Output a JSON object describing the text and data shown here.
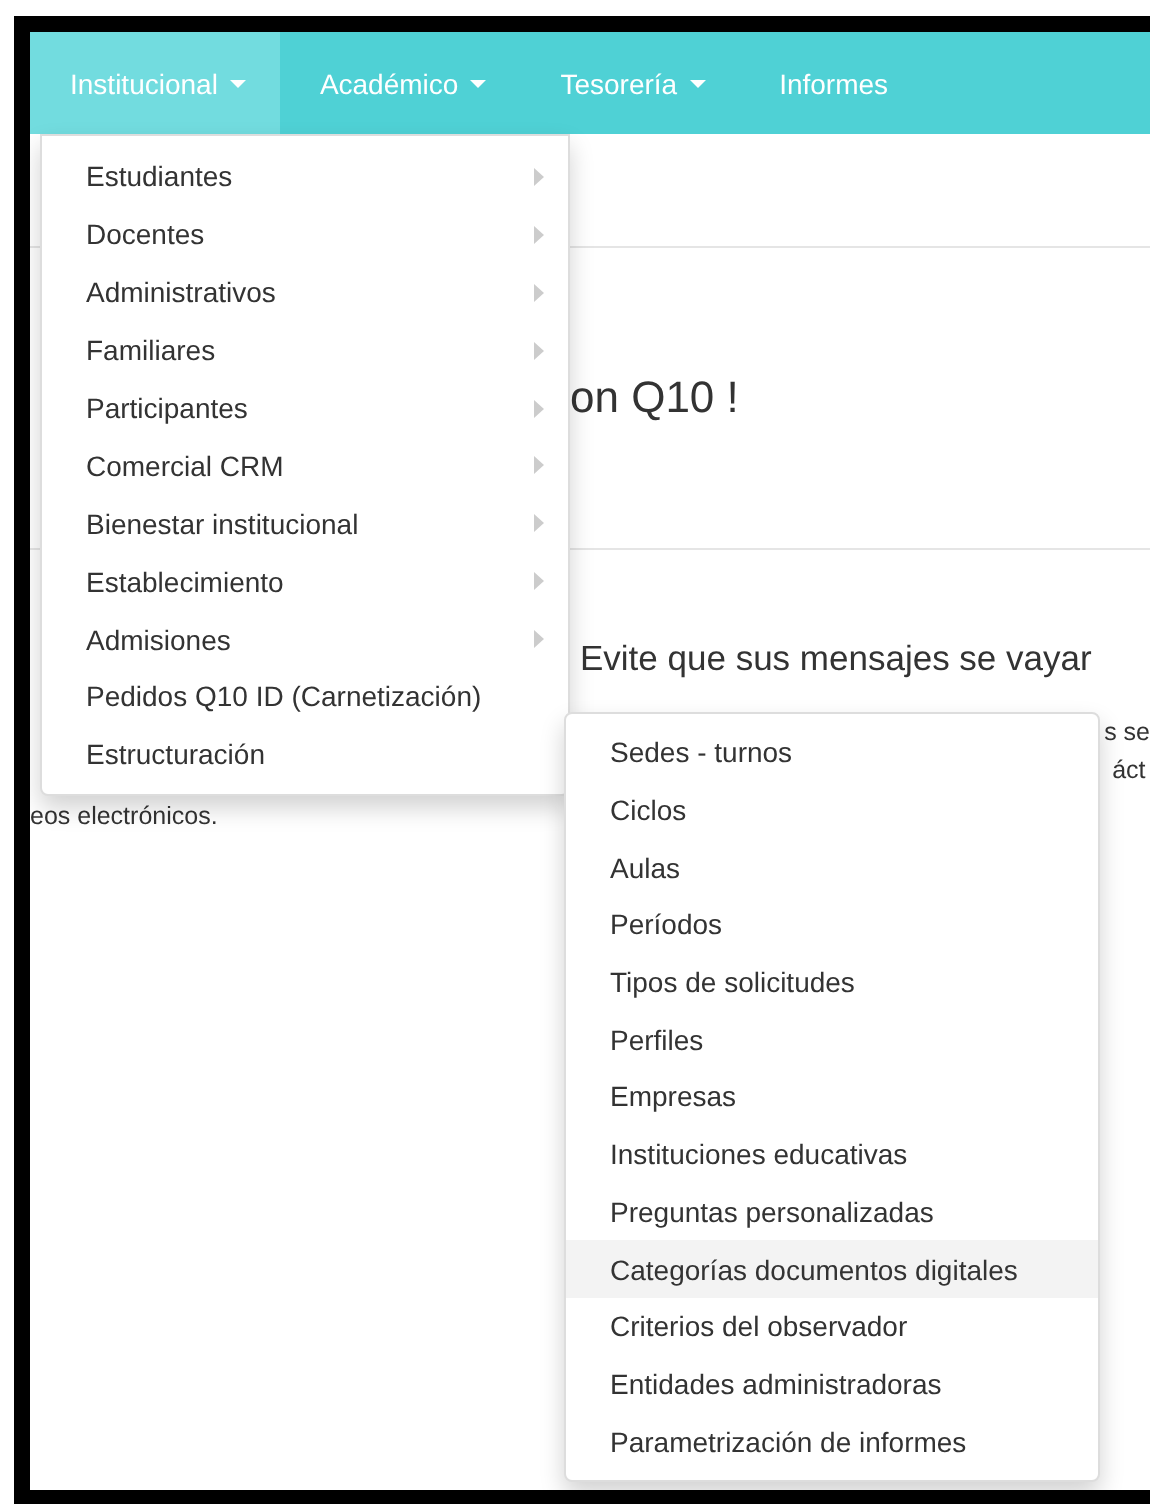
{
  "navbar": {
    "items": [
      {
        "label": "Institucional",
        "dropdown": true,
        "selected": true
      },
      {
        "label": "Académico",
        "dropdown": true,
        "selected": false
      },
      {
        "label": "Tesorería",
        "dropdown": true,
        "selected": false
      },
      {
        "label": "Informes",
        "dropdown": false,
        "selected": false
      }
    ]
  },
  "background": {
    "heading_right": "on Q10 !",
    "subheading": "Evite que sus mensajes se vayar",
    "text_left": [
      "eos electrónicos."
    ],
    "text_right": [
      "s se",
      "áct"
    ]
  },
  "menu": {
    "items": [
      {
        "label": "Estudiantes",
        "submenu": true
      },
      {
        "label": "Docentes",
        "submenu": true
      },
      {
        "label": "Administrativos",
        "submenu": true
      },
      {
        "label": "Familiares",
        "submenu": true
      },
      {
        "label": "Participantes",
        "submenu": true
      },
      {
        "label": "Comercial CRM",
        "submenu": true
      },
      {
        "label": "Bienestar institucional",
        "submenu": true
      },
      {
        "label": "Establecimiento",
        "submenu": true
      },
      {
        "label": "Admisiones",
        "submenu": true
      },
      {
        "label": "Pedidos Q10 ID (Carnetización)",
        "submenu": false
      },
      {
        "label": "Estructuración",
        "submenu": false
      }
    ]
  },
  "submenu": {
    "items": [
      {
        "label": "Sedes - turnos",
        "selected": false
      },
      {
        "label": "Ciclos",
        "selected": false
      },
      {
        "label": "Aulas",
        "selected": false
      },
      {
        "label": "Períodos",
        "selected": false
      },
      {
        "label": "Tipos de solicitudes",
        "selected": false
      },
      {
        "label": "Perfiles",
        "selected": false
      },
      {
        "label": "Empresas",
        "selected": false
      },
      {
        "label": "Instituciones educativas",
        "selected": false
      },
      {
        "label": "Preguntas personalizadas",
        "selected": false
      },
      {
        "label": "Categorías documentos digitales",
        "selected": true
      },
      {
        "label": "Criterios del observador",
        "selected": false
      },
      {
        "label": "Entidades administradoras",
        "selected": false
      },
      {
        "label": "Parametrización de informes",
        "selected": false
      }
    ]
  }
}
